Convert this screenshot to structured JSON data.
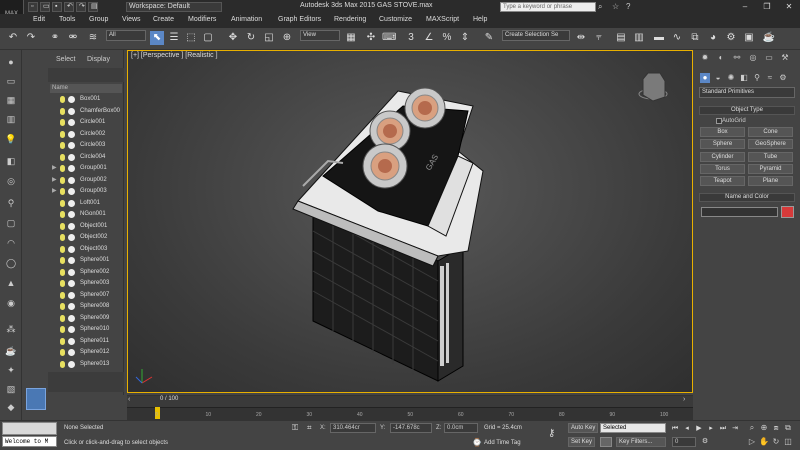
{
  "titlebar": {
    "logo": "MAX",
    "workspace": "Workspace: Default",
    "title": "Autodesk 3ds Max  2015      GAS STOVE.max",
    "search_placeholder": "Type a keyword or phrase"
  },
  "menus": [
    "Edit",
    "Tools",
    "Group",
    "Views",
    "Create",
    "Modifiers",
    "Animation",
    "Graph Editors",
    "Rendering",
    "Customize",
    "MAXScript",
    "Help"
  ],
  "toolbar": {
    "filter": "All",
    "view": "View",
    "selection_set": "Create Selection Se"
  },
  "explorer": {
    "tabs": [
      "Select",
      "Display"
    ],
    "column": "Name",
    "items": [
      {
        "label": "Box001",
        "group": false
      },
      {
        "label": "ChamferBox00",
        "group": false
      },
      {
        "label": "Circle001",
        "group": false
      },
      {
        "label": "Circle002",
        "group": false
      },
      {
        "label": "Circle003",
        "group": false
      },
      {
        "label": "Circle004",
        "group": false
      },
      {
        "label": "Group001",
        "group": true
      },
      {
        "label": "Group002",
        "group": true
      },
      {
        "label": "Group003",
        "group": true
      },
      {
        "label": "Loft001",
        "group": false
      },
      {
        "label": "NGon001",
        "group": false
      },
      {
        "label": "Object001",
        "group": false
      },
      {
        "label": "Object002",
        "group": false
      },
      {
        "label": "Object003",
        "group": false
      },
      {
        "label": "Sphere001",
        "group": false
      },
      {
        "label": "Sphere002",
        "group": false
      },
      {
        "label": "Sphere003",
        "group": false
      },
      {
        "label": "Sphere007",
        "group": false
      },
      {
        "label": "Sphere008",
        "group": false
      },
      {
        "label": "Sphere009",
        "group": false
      },
      {
        "label": "Sphere010",
        "group": false
      },
      {
        "label": "Sphere011",
        "group": false
      },
      {
        "label": "Sphere012",
        "group": false
      },
      {
        "label": "Sphere013",
        "group": false
      }
    ]
  },
  "viewport": {
    "label": "[+] [Perspective ] [Realistic ]",
    "border_color": "#e8b000"
  },
  "command_panel": {
    "category": "Standard Primitives",
    "object_type_title": "Object Type",
    "autogrid": "AutoGrid",
    "buttons": [
      "Box",
      "Cone",
      "Sphere",
      "GeoSphere",
      "Cylinder",
      "Tube",
      "Torus",
      "Pyramid",
      "Teapot",
      "Plane"
    ],
    "name_color_title": "Name and Color",
    "color": "#d63a3a"
  },
  "timeline": {
    "frame": "0 / 100",
    "ticks": [
      "0",
      "10",
      "20",
      "30",
      "40",
      "50",
      "60",
      "70",
      "80",
      "90",
      "100"
    ]
  },
  "status": {
    "listener": "Welcome to M",
    "selection": "None Selected",
    "prompt": "Click or click-and-drag to select objects",
    "x_label": "X:",
    "x": "310.464cr",
    "y_label": "Y:",
    "y": "-147.678c",
    "z_label": "Z:",
    "z": "0.0cm",
    "grid": "Grid = 25.4cm",
    "add_time_tag": "Add Time Tag",
    "auto_key": "Auto Key",
    "set_key": "Set Key",
    "selected": "Selected",
    "key_filters": "Key Filters...",
    "frame_field": "0"
  }
}
